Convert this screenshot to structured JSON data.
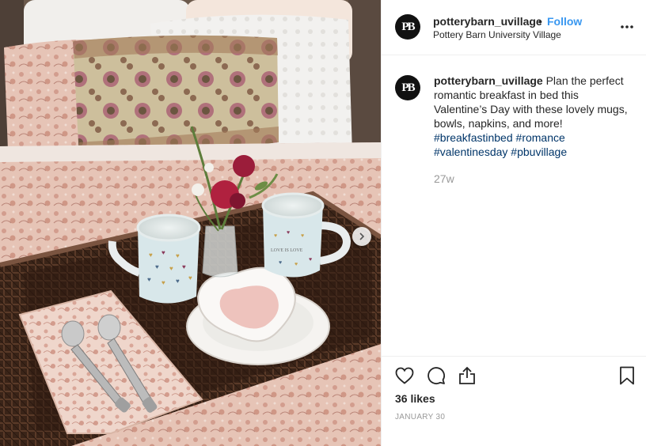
{
  "post": {
    "username": "potterybarn_uvillage",
    "separator": "•",
    "follow_label": "Follow",
    "location": "Pottery Barn University Village",
    "avatar_text": "PB",
    "caption_text": "Plan the perfect romantic breakfast in bed this Valentine’s Day with these lovely mugs, bowls, napkins, and more!",
    "hashtags": [
      "#breakfastinbed",
      "#romance",
      "#valentinesday",
      "#pbuvillage"
    ],
    "time_ago": "27w",
    "likes": "36 likes",
    "date": "JANUARY 30"
  },
  "photo": {
    "mug_text": "LOVE IS LOVE",
    "icons": {
      "next": "chevron-right-icon",
      "more": "more-options-icon",
      "like": "heart-icon",
      "comment": "comment-icon",
      "share": "share-icon",
      "save": "bookmark-icon"
    }
  }
}
